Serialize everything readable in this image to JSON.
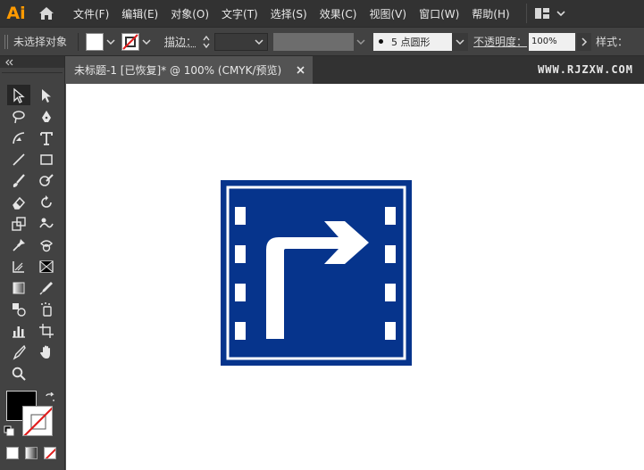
{
  "app": {
    "logo": "Ai"
  },
  "menu": {
    "items": [
      "文件(F)",
      "编辑(E)",
      "对象(O)",
      "文字(T)",
      "选择(S)",
      "效果(C)",
      "视图(V)",
      "窗口(W)",
      "帮助(H)"
    ]
  },
  "control_bar": {
    "selection_status": "未选择对象",
    "stroke_label": "描边：",
    "brush_value": "5 点圆形",
    "opacity_label": "不透明度：",
    "opacity_value": "100%",
    "style_label": "样式："
  },
  "document": {
    "tab_title": "未标题-1 [已恢复]* @ 100% (CMYK/预览)",
    "watermark": "WWW.RJZXW.COM"
  },
  "icons": {
    "home": "home-icon",
    "workspace": "workspace-switcher-icon",
    "close": "close-icon"
  },
  "colors": {
    "sign_blue": "#06348c",
    "sign_white": "#ffffff",
    "ai_orange": "#ff9a00",
    "fill_swatch": "#000000",
    "stroke_swatch": "#ffffff",
    "no_color_slash": "#e01e1e"
  }
}
